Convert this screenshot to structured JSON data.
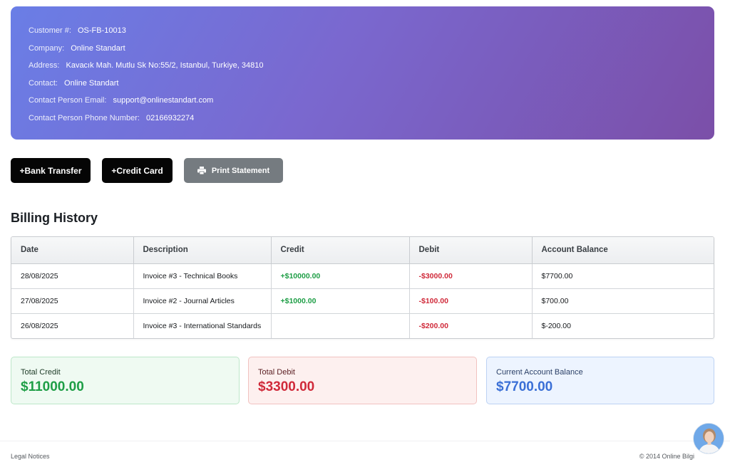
{
  "customer": {
    "fields": [
      {
        "label": "Customer #:",
        "value": "OS-FB-10013"
      },
      {
        "label": "Company:",
        "value": "Online Standart"
      },
      {
        "label": "Address:",
        "value": "Kavacık Mah. Mutlu Sk No:55/2, Istanbul, Turkiye, 34810"
      },
      {
        "label": "Contact:",
        "value": "Online Standart"
      },
      {
        "label": "Contact Person Email:",
        "value": "support@onlinestandart.com"
      },
      {
        "label": "Contact Person Phone Number:",
        "value": "02166932274"
      }
    ],
    "gradient_colors": [
      "#6a7ee6",
      "#7b4fa8"
    ]
  },
  "actions": {
    "bank_transfer_label": "+Bank Transfer",
    "credit_card_label": "+Credit Card",
    "print_label": "Print Statement",
    "print_icon": "printer-icon"
  },
  "billing": {
    "title": "Billing History",
    "columns": [
      "Date",
      "Description",
      "Credit",
      "Debit",
      "Account Balance"
    ],
    "rows": [
      {
        "date": "28/08/2025",
        "description": "Invoice #3 - Technical Books",
        "credit": "+$10000.00",
        "debit": "-$3000.00",
        "balance": "$7700.00"
      },
      {
        "date": "27/08/2025",
        "description": "Invoice #2 - Journal Articles",
        "credit": "+$1000.00",
        "debit": "-$100.00",
        "balance": "$700.00"
      },
      {
        "date": "26/08/2025",
        "description": "Invoice #3 - International Standards",
        "credit": "",
        "debit": "-$200.00",
        "balance": "$-200.00"
      }
    ]
  },
  "summary": {
    "total_credit_label": "Total Credit",
    "total_credit_value": "$11000.00",
    "total_debit_label": "Total Debit",
    "total_debit_value": "$3300.00",
    "balance_label": "Current Account Balance",
    "balance_value": "$7700.00"
  },
  "colors": {
    "credit": "#1e9e46",
    "debit": "#d02a3a",
    "balance": "#3a6fd6"
  },
  "footer": {
    "legal": "Legal Notices",
    "copyright": "© 2014 Online Bilgi"
  }
}
